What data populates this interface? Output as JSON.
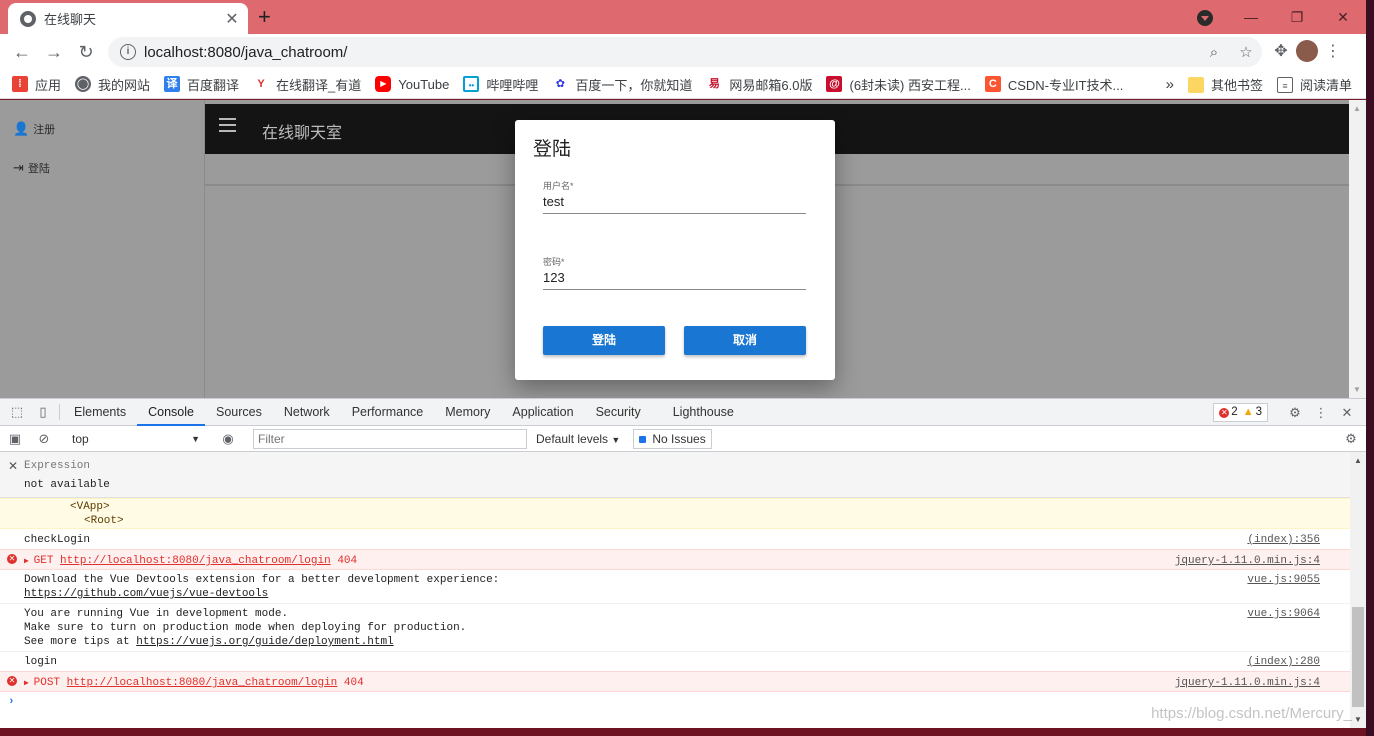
{
  "browser": {
    "tab_title": "在线聊天",
    "tab_close": "✕",
    "new_tab": "+",
    "win_min": "—",
    "win_max": "❐",
    "win_close": "✕",
    "url": "localhost:8080/java_chatroom/"
  },
  "bookmarks": {
    "items": [
      {
        "label": "应用",
        "icon": "apps-grid-icon",
        "color": "#ea4335"
      },
      {
        "label": "我的网站",
        "icon": "globe-icon",
        "color": "#5f6368"
      },
      {
        "label": "百度翻译",
        "icon": "baidu-translate-icon",
        "color": "#2f80ed"
      },
      {
        "label": "在线翻译_有道",
        "icon": "youdao-icon",
        "color": "#e0302b"
      },
      {
        "label": "YouTube",
        "icon": "youtube-icon",
        "color": "#ff0000"
      },
      {
        "label": "哔哩哔哩",
        "icon": "bilibili-icon",
        "color": "#00a1d6"
      },
      {
        "label": "百度一下，你就知道",
        "icon": "baidu-paw-icon",
        "color": "#2932e1"
      },
      {
        "label": "网易邮箱6.0版",
        "icon": "netease-mail-icon",
        "color": "#c8102e"
      },
      {
        "label": "(6封未读) 西安工程...",
        "icon": "mail-at-icon",
        "color": "#c8102e"
      },
      {
        "label": "CSDN-专业IT技术...",
        "icon": "csdn-icon",
        "color": "#fc5531"
      }
    ],
    "more": "»",
    "other": "其他书签",
    "reading": "阅读清单"
  },
  "page": {
    "drawer_register": "注册",
    "drawer_login": "登陆",
    "appbar_title": "在线聊天室"
  },
  "dialog": {
    "title": "登陆",
    "username_label": "用户名*",
    "username_value": "test",
    "password_label": "密码*",
    "password_value": "123",
    "login_button": "登陆",
    "cancel_button": "取消"
  },
  "devtools": {
    "tabs": [
      "Elements",
      "Console",
      "Sources",
      "Network",
      "Performance",
      "Memory",
      "Application",
      "Security",
      "Lighthouse"
    ],
    "active_tab": "Console",
    "error_count": "2",
    "warning_count": "3",
    "context": "top",
    "filter_placeholder": "Filter",
    "levels": "Default levels",
    "issues": "No Issues",
    "expression_label": "Expression",
    "expression_value": "not available",
    "vapp_line1": "<VApp>",
    "vapp_line2": "<Root>",
    "log1_msg": "checkLogin",
    "log1_src": "(index):356",
    "err1_method": "GET",
    "err1_url": "http://localhost:8080/java_chatroom/login",
    "err1_code": "404",
    "err1_src": "jquery-1.11.0.min.js:4",
    "log2_line1": "Download the Vue Devtools extension for a better development experience:",
    "log2_link": "https://github.com/vuejs/vue-devtools",
    "log2_src": "vue.js:9055",
    "log3_line1": "You are running Vue in development mode.",
    "log3_line2": "Make sure to turn on production mode when deploying for production.",
    "log3_line3_prefix": "See more tips at ",
    "log3_link": "https://vuejs.org/guide/deployment.html",
    "log3_src": "vue.js:9064",
    "log4_msg": "login",
    "log4_src": "(index):280",
    "err2_method": "POST",
    "err2_url": "http://localhost:8080/java_chatroom/login",
    "err2_code": "404",
    "err2_src": "jquery-1.11.0.min.js:4",
    "prompt": "›",
    "watermark": "https://blog.csdn.net/Mercury_"
  }
}
